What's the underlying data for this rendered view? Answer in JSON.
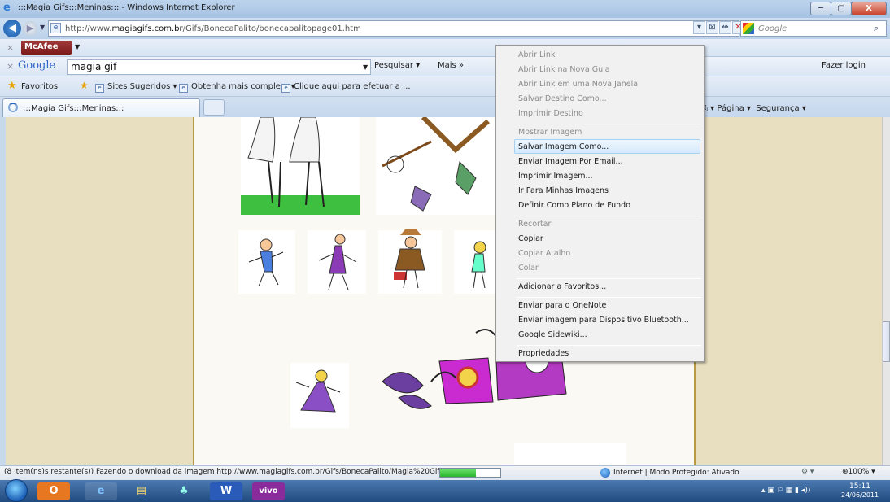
{
  "window": {
    "title": ":::Magia Gifs:::Meninas::: - Windows Internet Explorer",
    "min": "─",
    "max": "▢",
    "close": "X"
  },
  "address": {
    "url_prefix": "http://www.",
    "url_domain": "magiagifs.com.br",
    "url_path": "/Gifs/BonecaPalito/bonecapalitopage01.htm",
    "actions": [
      "▾",
      "⊠",
      "↮",
      "✕"
    ]
  },
  "search": {
    "placeholder": "Google",
    "icon": "search-icon"
  },
  "mcafee": {
    "label": "McAfee"
  },
  "google_toolbar": {
    "logo": "Google",
    "query": "magia gif",
    "search_btn": "Pesquisar ▾",
    "more": "Mais »",
    "login": "Fazer login"
  },
  "favorites": {
    "label": "Favoritos",
    "links": [
      "Sites Sugeridos ▾",
      "Obtenha mais comple... ▾",
      "Clique aqui para efetuar a ..."
    ]
  },
  "tab": {
    "label": ":::Magia Gifs:::Meninas:::"
  },
  "command_bar": {
    "page": "Página ▾",
    "security": "Segurança ▾"
  },
  "context_menu": {
    "items": [
      {
        "label": "Abrir Link",
        "disabled": true
      },
      {
        "label": "Abrir Link na Nova Guia",
        "disabled": true
      },
      {
        "label": "Abrir Link em uma Nova Janela",
        "disabled": true
      },
      {
        "label": "Salvar Destino Como...",
        "disabled": true
      },
      {
        "label": "Imprimir Destino",
        "disabled": true
      },
      {
        "label": "Mostrar Imagem",
        "disabled": true
      },
      {
        "label": "Salvar Imagem Como...",
        "disabled": false,
        "highlighted": true
      },
      {
        "label": "Enviar Imagem Por Email...",
        "disabled": false
      },
      {
        "label": "Imprimir Imagem...",
        "disabled": false
      },
      {
        "label": "Ir Para Minhas Imagens",
        "disabled": false
      },
      {
        "label": "Definir Como Plano de Fundo",
        "disabled": false
      },
      {
        "label": "Recortar",
        "disabled": true
      },
      {
        "label": "Copiar",
        "disabled": false
      },
      {
        "label": "Copiar Atalho",
        "disabled": true
      },
      {
        "label": "Colar",
        "disabled": true
      },
      {
        "label": "Adicionar a Favoritos...",
        "disabled": false
      },
      {
        "label": "Enviar para o OneNote",
        "disabled": false
      },
      {
        "label": "Enviar imagem para Dispositivo Bluetooth...",
        "disabled": false
      },
      {
        "label": "Google Sidewiki...",
        "disabled": false
      },
      {
        "label": "Propriedades",
        "disabled": false
      }
    ]
  },
  "status": {
    "text": "(8 item(ns)s restante(s)) Fazendo o download da imagem http://www.magiagifs.com.br/Gifs/BonecaPalito/Magia%20Gif's_arc",
    "progress": 0.6,
    "zone": "Internet | Modo Protegido: Ativado",
    "zoom": "100%"
  },
  "taskbar": {
    "apps": [
      "O",
      "e",
      "▤",
      "♣",
      "W",
      "vivo"
    ],
    "time": "15:11",
    "date": "24/06/2011"
  },
  "colors": {
    "accent": "#2b62b3",
    "page_bg": "#e8dec0",
    "frame": "#b89a46"
  }
}
